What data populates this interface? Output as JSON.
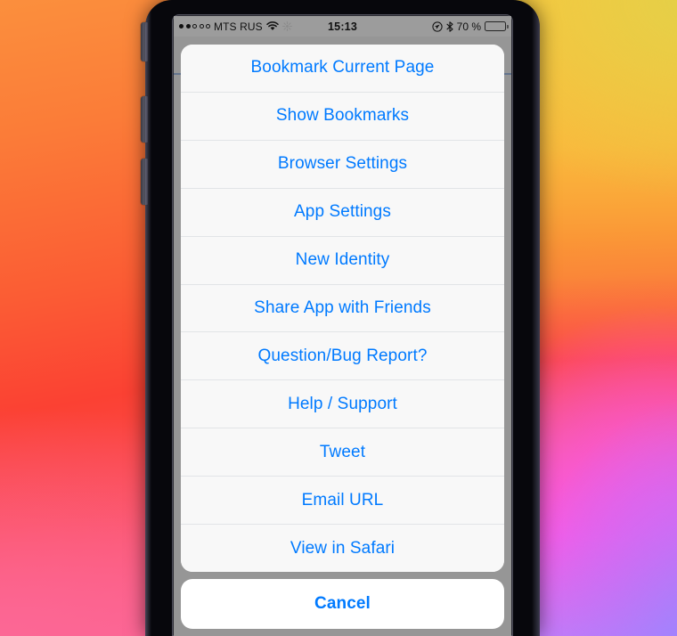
{
  "status_bar": {
    "signal_dots_filled": 2,
    "signal_dots_total": 5,
    "carrier": "MTS RUS",
    "wifi_icon": "wifi-icon",
    "activity_icon": "network-activity-icon",
    "time": "15:13",
    "location_icon": "location-arrow-icon",
    "bluetooth_icon": "bluetooth-icon",
    "battery_percent_label": "70 %",
    "battery_level": 70
  },
  "action_sheet": {
    "items": [
      {
        "label": "Bookmark Current Page"
      },
      {
        "label": "Show Bookmarks"
      },
      {
        "label": "Browser Settings"
      },
      {
        "label": "App Settings"
      },
      {
        "label": "New Identity"
      },
      {
        "label": "Share App with Friends"
      },
      {
        "label": "Question/Bug Report?"
      },
      {
        "label": "Help / Support"
      },
      {
        "label": "Tweet"
      },
      {
        "label": "Email URL"
      },
      {
        "label": "View in Safari"
      }
    ],
    "cancel_label": "Cancel"
  },
  "colors": {
    "accent_blue": "#007aff",
    "sheet_background": "#f8f8f8",
    "cancel_background": "#ffffff",
    "separator": "#e2e4e7",
    "status_bar_background": "#9c9c9c",
    "progress_bar": "#1b65d6"
  }
}
